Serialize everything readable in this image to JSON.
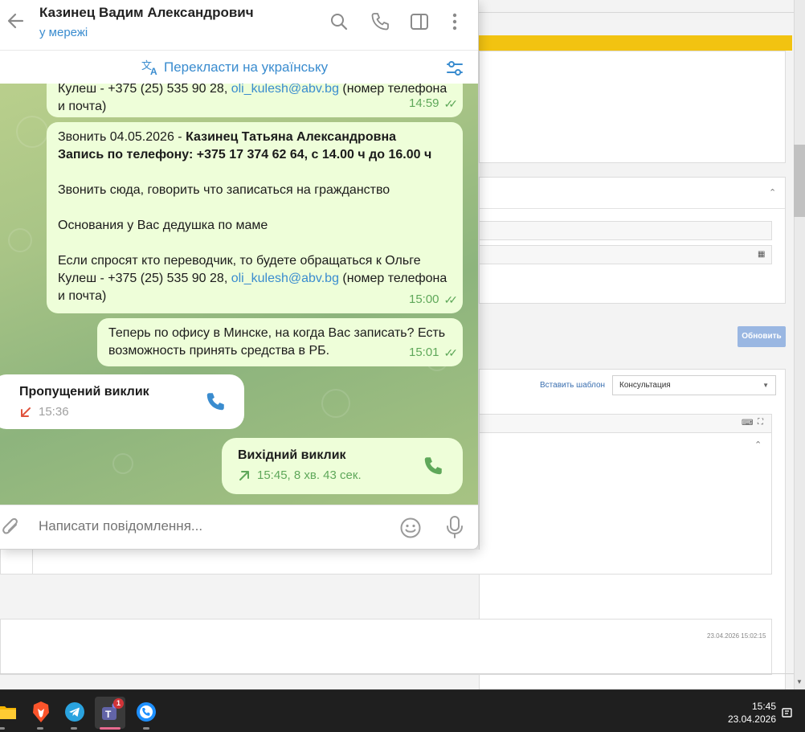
{
  "telegram": {
    "header": {
      "chat_name": "Казинец Вадим Александрович",
      "status": "у мережі"
    },
    "translate_label": "Перекласти на українську",
    "messages": [
      {
        "line1": "Кулеш - +375 (25) 535 90 28, ",
        "email": "oli_kulesh@abv.bg",
        "line1_tail": " (номер телефона",
        "line2": "и почта)",
        "time": "14:59"
      },
      {
        "intro": "Звонить 04.05.2026 - ",
        "person": "Казинец Татьяна Александровна",
        "bold_line": "Запись по телефону: +375 17 374 62 64, с 14.00 ч до 16.00 ч",
        "p1": " Звонить сюда, говорить что записаться на гражданство",
        "p2": "Основания у Вас дедушка по маме",
        "p3a": "Если спросят кто переводчик, то будете обращаться к Ольге",
        "p3b": "Кулеш - +375 (25) 535 90 28, ",
        "email": "oli_kulesh@abv.bg",
        "p3b_tail": " (номер телефона",
        "p3c": "и почта)",
        "time": "15:00"
      },
      {
        "line1": "Теперь по офису в Минске, на когда Вас записать? Есть",
        "line2": "возможность принять средства в РБ.",
        "time": "15:01"
      }
    ],
    "missed_call": {
      "title": "Пропущений виклик",
      "time": "15:36"
    },
    "outgoing_call": {
      "title": "Вихідний виклик",
      "detail": "15:45, 8 хв. 43 сек."
    },
    "composer_placeholder": "Написати повідомлення..."
  },
  "background_app": {
    "update_button": "Обновить",
    "insert_template": "Вставить шаблон",
    "template_select": "Консультация",
    "timestamp": "23.04.2026 15:02:15"
  },
  "taskbar": {
    "time": "15:45",
    "date": "23.04.2026",
    "teams_badge": "1"
  },
  "colors": {
    "accent": "#3a8ccf",
    "bubble_out": "#eefed9",
    "check": "#5fa85a",
    "missed": "#e0533d",
    "highlight": "#f2c311"
  }
}
